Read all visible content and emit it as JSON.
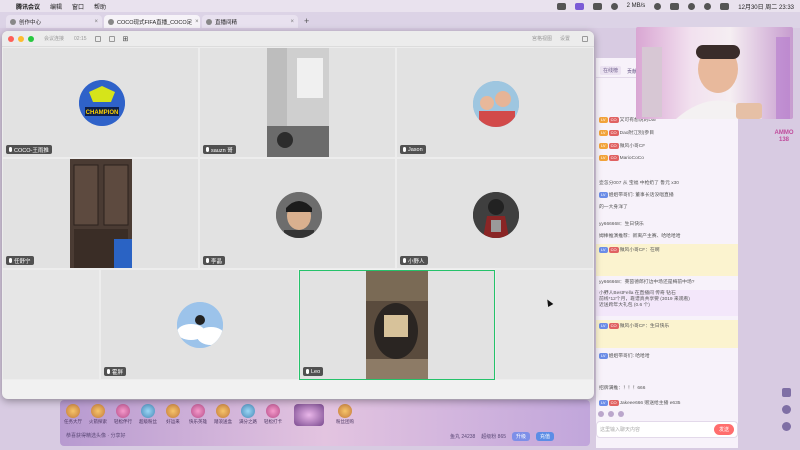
{
  "menubar": {
    "app_name": "腾讯会议",
    "items": [
      "编辑",
      "窗口",
      "帮助"
    ],
    "network": "2 MB/s",
    "clock": "12月30日 周二 23:33"
  },
  "browser_tabs": [
    {
      "label": "创作中心",
      "active": false
    },
    {
      "label": "COCO现式FIFA直播_COCO足",
      "active": true
    },
    {
      "label": "直播间精",
      "active": false
    }
  ],
  "meeting": {
    "status": "会议连接",
    "time": "02:15",
    "right_controls": [
      "宫格视图",
      "设置"
    ],
    "participants": [
      {
        "name": "COCO-王雨推"
      },
      {
        "name": "sauzn 哥"
      },
      {
        "name": "Jason"
      },
      {
        "name": "任舒宁"
      },
      {
        "name": "李晶"
      },
      {
        "name": "小野人"
      },
      {
        "name": "霍胖"
      },
      {
        "name": "Leo"
      }
    ]
  },
  "chat": {
    "tabs": [
      "在线榜",
      "贡献榜"
    ],
    "messages": [
      {
        "text": "又可有想说的Dar"
      },
      {
        "text": "Dao附江別(参目"
      },
      {
        "text": "微风小哥CF"
      },
      {
        "text": "MarioCoCo"
      },
      {
        "text": "壶怎分007 从 宝福 中枪奶了 鲁元 x30"
      },
      {
        "text": "姐姐带哥们: 董事长话没唱直播"
      },
      {
        "text": "的一大身洋了"
      },
      {
        "text": "yy666668：生日快乐"
      },
      {
        "text": "姆棒推演推荐：新离产主赛、哈哈哈哈"
      },
      {
        "text": "微风小哥CF：在啊"
      },
      {
        "text": "yy666668：莱茵德郎打边中场还是梅前中场?"
      },
      {
        "text": "小野人BestFella 在直播间 传奇 钻石"
      },
      {
        "text": "前线*12个月，靠谱真共享要 (3019 来观看)"
      },
      {
        "text": "近送跨年大礼包 (0.6 个)"
      },
      {
        "text": "微风小哥CF：生日快乐"
      },
      {
        "text": "姐姐带哥们: 哈哈哈"
      },
      {
        "text": "招牌满推：！！！666"
      },
      {
        "text": "Jakeee666 赠送给主播 e635"
      }
    ],
    "input_placeholder": "这里输入聊天内容",
    "send_label": "发送"
  },
  "stream_bottom": {
    "gifts": [
      "任务大厅",
      "火箭探索",
      "轻松伴行",
      "超级粉丝",
      "好运来",
      "快乐英雄",
      "踏浪送盒",
      "满分之路",
      "轻松打卡",
      "",
      "",
      "粉丝团购"
    ],
    "notice": "恭喜获得精选头像 · 分享好",
    "stats": [
      "鱼丸 24238",
      "超级粉 865"
    ],
    "buttons": [
      "升级",
      "充值"
    ]
  },
  "right_rail": {
    "badge": "AMMO 138"
  },
  "colors": {
    "speaking_border": "#25c26a",
    "send_button": "#ff6d6d",
    "stream_bg": "#d8cbe2"
  }
}
